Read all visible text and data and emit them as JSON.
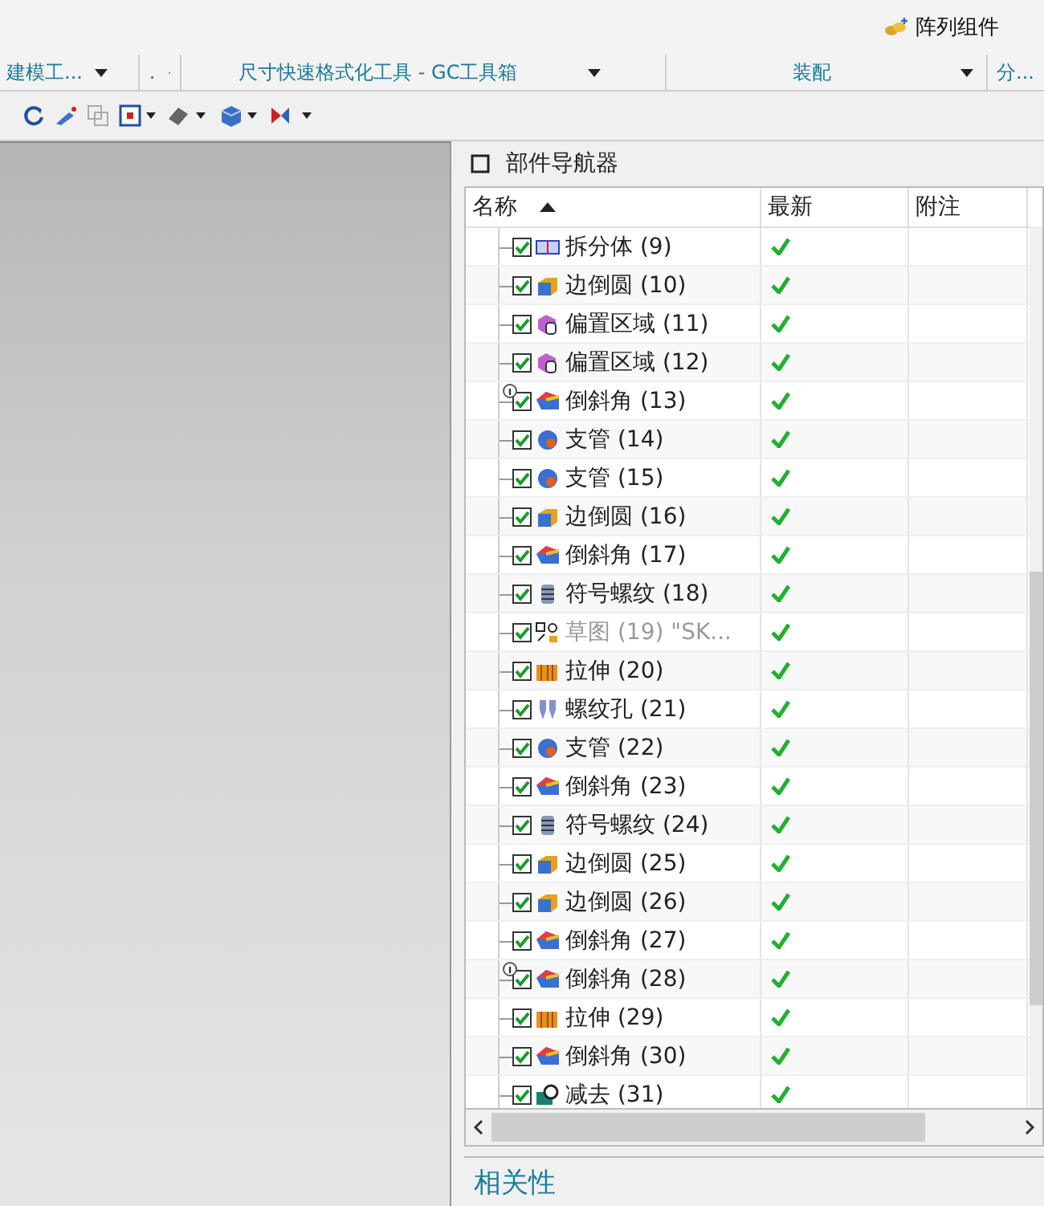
{
  "ribbon": {
    "groups": [
      {
        "label": "建模工..."
      },
      {
        "label": "."
      },
      {
        "label": "尺寸快速格式化工具 - GC工具箱"
      },
      {
        "label": "装配"
      },
      {
        "label": "分..."
      }
    ],
    "array_button": "阵列组件"
  },
  "navigator": {
    "title": "部件导航器",
    "columns": [
      {
        "label": "名称",
        "sorted": true
      },
      {
        "label": "最新",
        "sorted": false
      },
      {
        "label": "附注",
        "sorted": false
      }
    ],
    "rows": [
      {
        "name": "拆分体 (9)",
        "kind": "split",
        "checked": true,
        "info": false,
        "disabled": false,
        "up_to_date": true
      },
      {
        "name": "边倒圆 (10)",
        "kind": "blend",
        "checked": true,
        "info": false,
        "disabled": false,
        "up_to_date": true
      },
      {
        "name": "偏置区域 (11)",
        "kind": "offset",
        "checked": true,
        "info": false,
        "disabled": false,
        "up_to_date": true
      },
      {
        "name": "偏置区域 (12)",
        "kind": "offset",
        "checked": true,
        "info": false,
        "disabled": false,
        "up_to_date": true
      },
      {
        "name": "倒斜角 (13)",
        "kind": "chamfer",
        "checked": true,
        "info": true,
        "disabled": false,
        "up_to_date": true
      },
      {
        "name": "支管 (14)",
        "kind": "tube",
        "checked": true,
        "info": false,
        "disabled": false,
        "up_to_date": true
      },
      {
        "name": "支管 (15)",
        "kind": "tube",
        "checked": true,
        "info": false,
        "disabled": false,
        "up_to_date": true
      },
      {
        "name": "边倒圆 (16)",
        "kind": "blend",
        "checked": true,
        "info": false,
        "disabled": false,
        "up_to_date": true
      },
      {
        "name": "倒斜角 (17)",
        "kind": "chamfer",
        "checked": true,
        "info": false,
        "disabled": false,
        "up_to_date": true
      },
      {
        "name": "符号螺纹 (18)",
        "kind": "thread",
        "checked": true,
        "info": false,
        "disabled": false,
        "up_to_date": true
      },
      {
        "name": "草图 (19) \"SK...",
        "kind": "sketch",
        "checked": true,
        "info": false,
        "disabled": true,
        "up_to_date": true
      },
      {
        "name": "拉伸 (20)",
        "kind": "extrude",
        "checked": true,
        "info": false,
        "disabled": false,
        "up_to_date": true
      },
      {
        "name": "螺纹孔 (21)",
        "kind": "hole",
        "checked": true,
        "info": false,
        "disabled": false,
        "up_to_date": true
      },
      {
        "name": "支管 (22)",
        "kind": "tube",
        "checked": true,
        "info": false,
        "disabled": false,
        "up_to_date": true
      },
      {
        "name": "倒斜角 (23)",
        "kind": "chamfer",
        "checked": true,
        "info": false,
        "disabled": false,
        "up_to_date": true
      },
      {
        "name": "符号螺纹 (24)",
        "kind": "thread",
        "checked": true,
        "info": false,
        "disabled": false,
        "up_to_date": true
      },
      {
        "name": "边倒圆 (25)",
        "kind": "blend",
        "checked": true,
        "info": false,
        "disabled": false,
        "up_to_date": true
      },
      {
        "name": "边倒圆 (26)",
        "kind": "blend",
        "checked": true,
        "info": false,
        "disabled": false,
        "up_to_date": true
      },
      {
        "name": "倒斜角 (27)",
        "kind": "chamfer",
        "checked": true,
        "info": false,
        "disabled": false,
        "up_to_date": true
      },
      {
        "name": "倒斜角 (28)",
        "kind": "chamfer",
        "checked": true,
        "info": true,
        "disabled": false,
        "up_to_date": true
      },
      {
        "name": "拉伸 (29)",
        "kind": "extrude",
        "checked": true,
        "info": false,
        "disabled": false,
        "up_to_date": true
      },
      {
        "name": "倒斜角 (30)",
        "kind": "chamfer",
        "checked": true,
        "info": false,
        "disabled": false,
        "up_to_date": true
      },
      {
        "name": "减去 (31)",
        "kind": "subtract",
        "checked": true,
        "info": false,
        "disabled": false,
        "up_to_date": true
      }
    ],
    "footer": "相关性"
  }
}
